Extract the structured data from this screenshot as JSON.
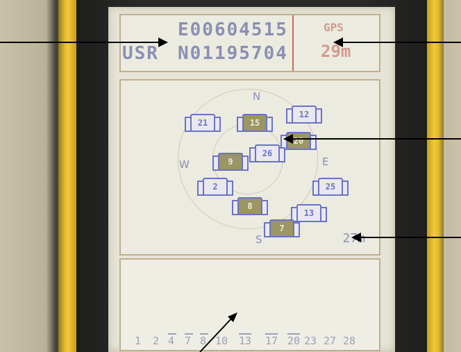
{
  "device": {
    "top": {
      "line1_value": "E00604515",
      "line2_prefix": "USR",
      "line2_value": "N01195704",
      "mode_label": "GPS",
      "altitude_value": "29m"
    },
    "skyplot": {
      "compass": {
        "north": "N",
        "west": "W",
        "east": "E",
        "south": "S"
      },
      "satellites": [
        {
          "id": "21",
          "fix": false
        },
        {
          "id": "15",
          "fix": true
        },
        {
          "id": "12",
          "fix": false
        },
        {
          "id": "20",
          "fix": true
        },
        {
          "id": "9",
          "fix": true
        },
        {
          "id": "26",
          "fix": false
        },
        {
          "id": "2",
          "fix": false
        },
        {
          "id": "25",
          "fix": false
        },
        {
          "id": "8",
          "fix": true
        },
        {
          "id": "13",
          "fix": false
        },
        {
          "id": "7",
          "fix": true
        }
      ],
      "accuracy_label": "27m"
    },
    "signal_bar_labels": [
      "1",
      "2",
      "4",
      "7",
      "8",
      "10",
      "13",
      "17",
      "20",
      "23",
      "27",
      "28"
    ]
  },
  "colors": {
    "lcd_background": "#e6e4d6",
    "lcd_blue": "#6a73c4",
    "lcd_red": "#d39a90",
    "housing_yellow": "#f2c93a"
  }
}
